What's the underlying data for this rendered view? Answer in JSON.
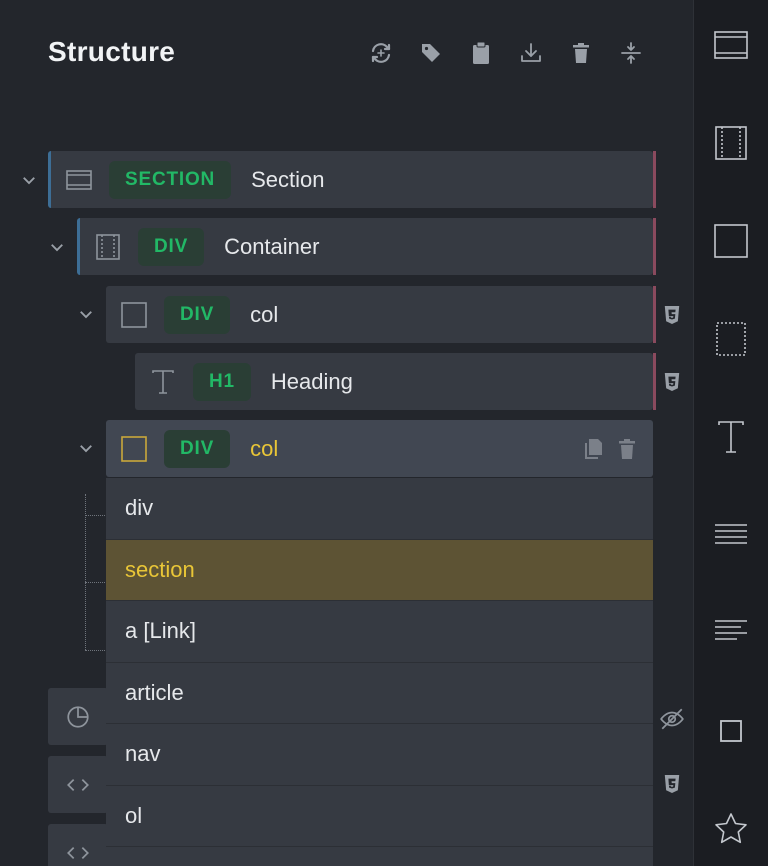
{
  "header": {
    "title": "Structure"
  },
  "toolbar": {
    "icons": [
      "sync-icon",
      "tag-icon",
      "clipboard-icon",
      "download-icon",
      "trash-icon",
      "collapse-icon"
    ]
  },
  "tree": {
    "rows": [
      {
        "tag": "SECTION",
        "label": "Section"
      },
      {
        "tag": "DIV",
        "label": "Container"
      },
      {
        "tag": "DIV",
        "label": "col"
      },
      {
        "tag": "H1",
        "label": "Heading"
      },
      {
        "tag": "DIV",
        "label": "col"
      }
    ]
  },
  "dropdown": {
    "options": [
      "div",
      "section",
      "a [Link]",
      "article",
      "nav",
      "ol"
    ],
    "selected": "section"
  },
  "colors": {
    "accent_blue": "#3d6e96",
    "accent_pink": "#8a4a5e",
    "tag_green": "#22b866",
    "active_yellow": "#e9c637"
  },
  "sidebar": {
    "icons": [
      "section-layout-icon",
      "container-icon",
      "block-icon",
      "div-dotted-icon",
      "text-icon",
      "paragraph-icon",
      "align-left-icon",
      "square-icon",
      "star-icon"
    ]
  }
}
